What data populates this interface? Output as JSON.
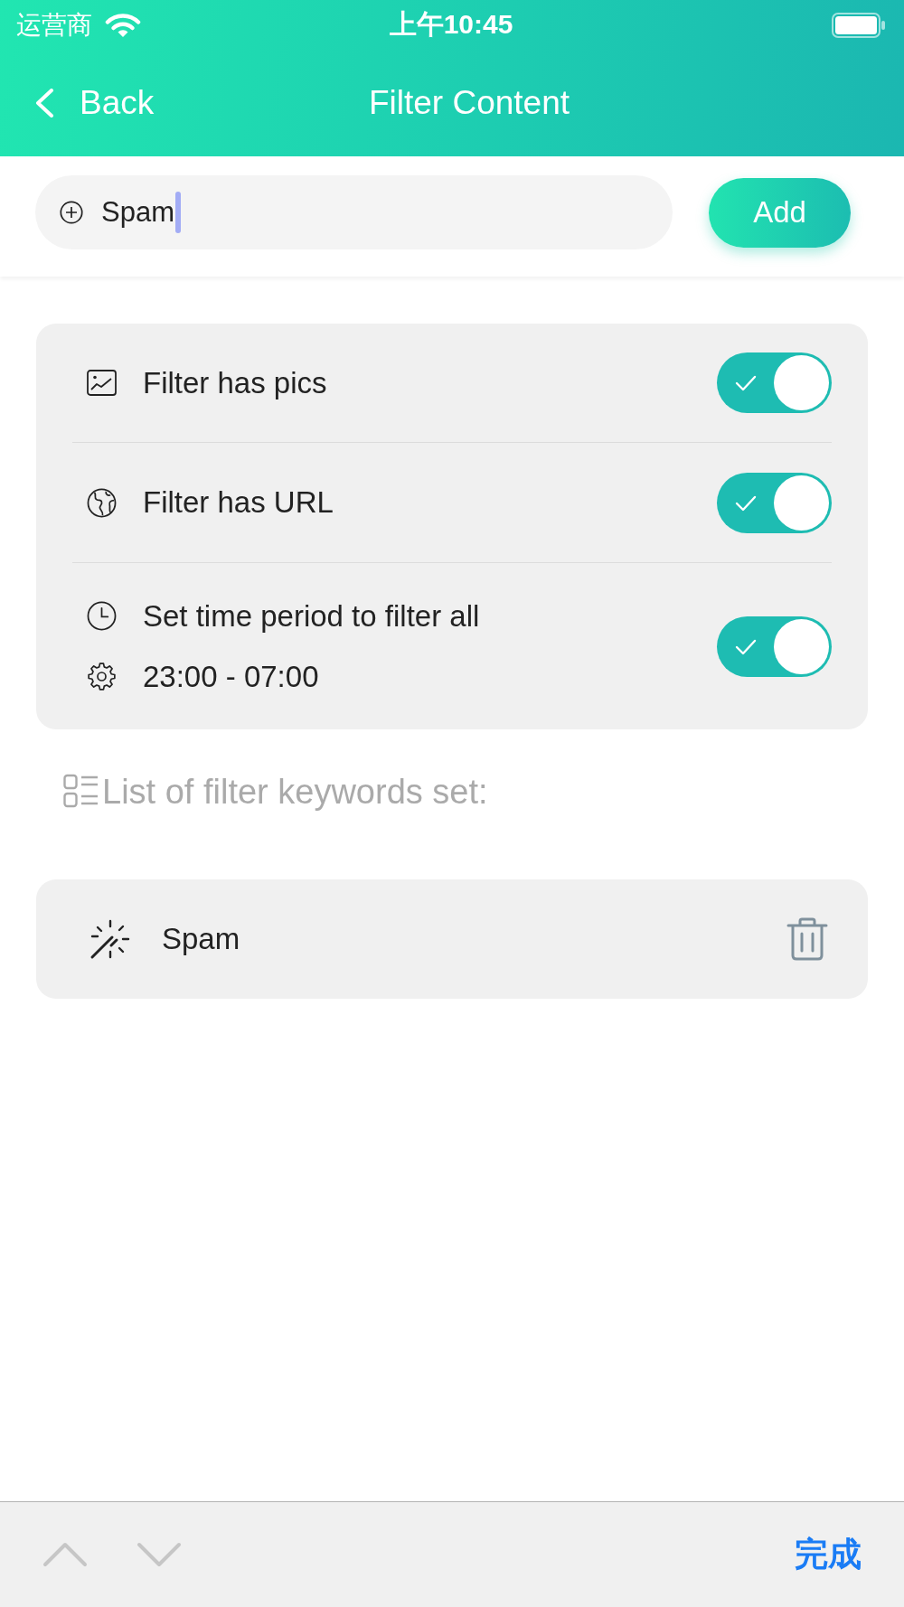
{
  "status_bar": {
    "carrier": "运营商",
    "time": "上午10:45"
  },
  "nav_bar": {
    "back": "Back",
    "title": "Filter Content"
  },
  "keyword_input": {
    "value": "Spam",
    "focused": true,
    "button": "Add"
  },
  "settings": [
    {
      "kind": "image",
      "label": "Filter has pics",
      "on": true
    },
    {
      "kind": "link",
      "label": "Filter has URL",
      "on": true
    },
    {
      "kind": "schedule",
      "label": "Set time period to filter all",
      "time_range": "23:00 - 07:00",
      "on": true
    }
  ],
  "keywords": {
    "heading": "List of filter keywords set:",
    "items": [
      {
        "text": "Spam"
      }
    ]
  },
  "keyboard_toolbar": {
    "done": "完成"
  }
}
